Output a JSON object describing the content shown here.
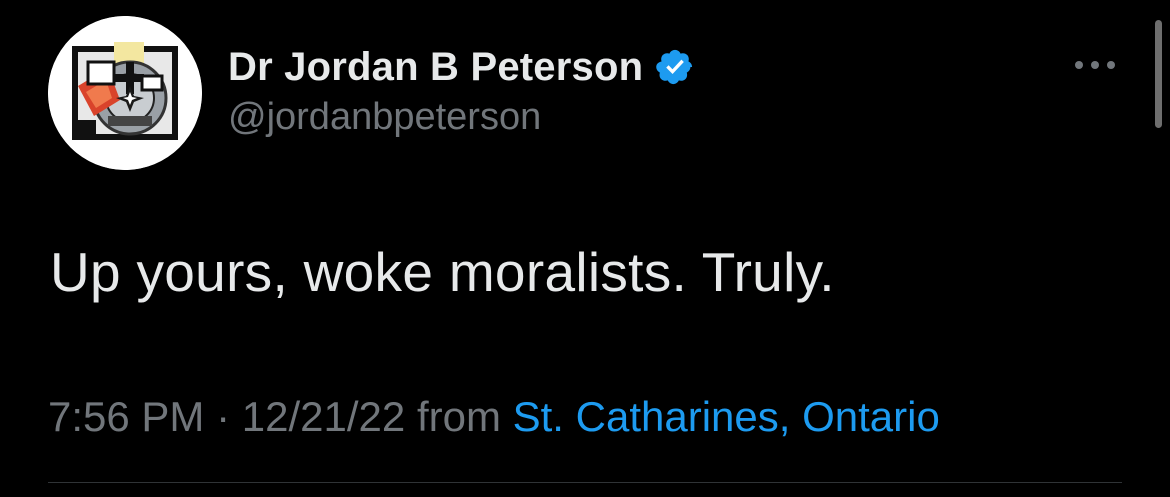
{
  "author": {
    "display_name": "Dr Jordan B Peterson",
    "handle": "@jordanbpeterson",
    "verified": true,
    "avatar_icon": "jordan-peterson-logo-avatar"
  },
  "tweet": {
    "text": "Up yours, woke moralists. Truly.",
    "time": "7:56 PM",
    "separator": "·",
    "date": "12/21/22",
    "from_label": "from",
    "location": "St. Catharines, Ontario"
  },
  "actions": {
    "more_icon": "more-horizontal-icon"
  },
  "colors": {
    "background": "#000000",
    "primary_text": "#e7e9ea",
    "secondary_text": "#71767b",
    "link": "#1d9bf0",
    "verified_badge": "#1d9bf0",
    "divider": "#2f3336"
  }
}
